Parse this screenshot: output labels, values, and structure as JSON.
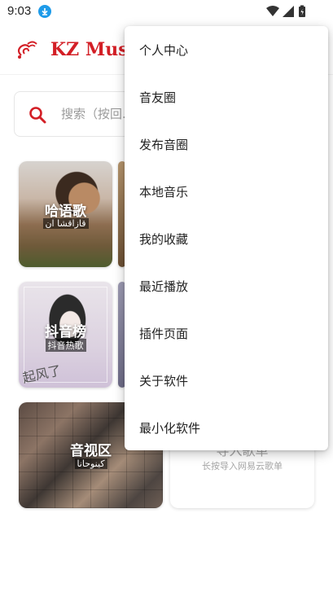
{
  "status_bar": {
    "time": "9:03",
    "icons": [
      "download-icon",
      "wifi-icon",
      "signal-icon",
      "battery-icon"
    ]
  },
  "header": {
    "title": "KZ Musi",
    "logo_icon": "swirl-logo-icon"
  },
  "search": {
    "placeholder": "搜索（按回..."
  },
  "cards": [
    {
      "title": "哈语歌",
      "subtitle": "قازاقشا ان"
    },
    {
      "title": "抖音榜",
      "subtitle": "抖音热歌",
      "signature": "起风了"
    },
    {
      "title": "音视区",
      "subtitle": "كينوحانا"
    }
  ],
  "import_card": {
    "title": "导入歌单",
    "subtitle": "长按导入网易云歌单"
  },
  "menu": {
    "items": [
      "个人中心",
      "音友圈",
      "发布音圈",
      "本地音乐",
      "我的收藏",
      "最近播放",
      "插件页面",
      "关于软件",
      "最小化软件"
    ]
  },
  "colors": {
    "brand": "#d31f26",
    "download_badge": "#1e9be9"
  }
}
